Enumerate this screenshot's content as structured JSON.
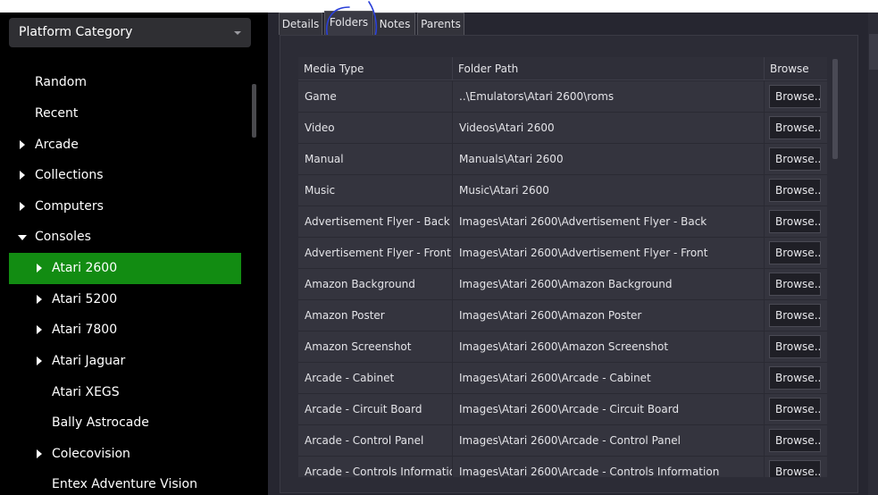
{
  "sidebar": {
    "dropdown_label": "Platform Category",
    "items": [
      {
        "label": "Random",
        "arrow": "none"
      },
      {
        "label": "Recent",
        "arrow": "none"
      },
      {
        "label": "Arcade",
        "arrow": "right"
      },
      {
        "label": "Collections",
        "arrow": "right"
      },
      {
        "label": "Computers",
        "arrow": "right"
      },
      {
        "label": "Consoles",
        "arrow": "down"
      },
      {
        "label": "Atari 2600",
        "arrow": "right",
        "selected": true
      },
      {
        "label": "Atari 5200",
        "arrow": "right"
      },
      {
        "label": "Atari 7800",
        "arrow": "right"
      },
      {
        "label": "Atari Jaguar",
        "arrow": "right"
      },
      {
        "label": "Atari XEGS",
        "arrow": "none"
      },
      {
        "label": "Bally Astrocade",
        "arrow": "none"
      },
      {
        "label": "Colecovision",
        "arrow": "right"
      },
      {
        "label": "Entex Adventure Vision",
        "arrow": "none"
      }
    ]
  },
  "tabs": [
    {
      "label": "Details"
    },
    {
      "label": "Folders",
      "active": true
    },
    {
      "label": "Notes"
    },
    {
      "label": "Parents"
    }
  ],
  "grid": {
    "headers": [
      "Media Type",
      "Folder Path",
      "Browse"
    ],
    "browse_label": "Browse...",
    "rows": [
      {
        "media_type": "Game",
        "folder_path": "..\\Emulators\\Atari 2600\\roms"
      },
      {
        "media_type": "Video",
        "folder_path": "Videos\\Atari 2600"
      },
      {
        "media_type": "Manual",
        "folder_path": "Manuals\\Atari 2600"
      },
      {
        "media_type": "Music",
        "folder_path": "Music\\Atari 2600"
      },
      {
        "media_type": "Advertisement Flyer - Back",
        "folder_path": "Images\\Atari 2600\\Advertisement Flyer - Back"
      },
      {
        "media_type": "Advertisement Flyer - Front",
        "folder_path": "Images\\Atari 2600\\Advertisement Flyer - Front"
      },
      {
        "media_type": "Amazon Background",
        "folder_path": "Images\\Atari 2600\\Amazon Background"
      },
      {
        "media_type": "Amazon Poster",
        "folder_path": "Images\\Atari 2600\\Amazon Poster"
      },
      {
        "media_type": "Amazon Screenshot",
        "folder_path": "Images\\Atari 2600\\Amazon Screenshot"
      },
      {
        "media_type": "Arcade - Cabinet",
        "folder_path": "Images\\Atari 2600\\Arcade - Cabinet"
      },
      {
        "media_type": "Arcade - Circuit Board",
        "folder_path": "Images\\Atari 2600\\Arcade - Circuit Board"
      },
      {
        "media_type": "Arcade - Control Panel",
        "folder_path": "Images\\Atari 2600\\Arcade - Control Panel"
      },
      {
        "media_type": "Arcade - Controls Information",
        "folder_path": "Images\\Atari 2600\\Arcade - Controls Information"
      }
    ]
  },
  "colors": {
    "selected_item": "#128c12",
    "annotation_ink": "#2a3fd8",
    "sidebar_bg": "#000000",
    "panel_bg": "#2c2c36"
  }
}
